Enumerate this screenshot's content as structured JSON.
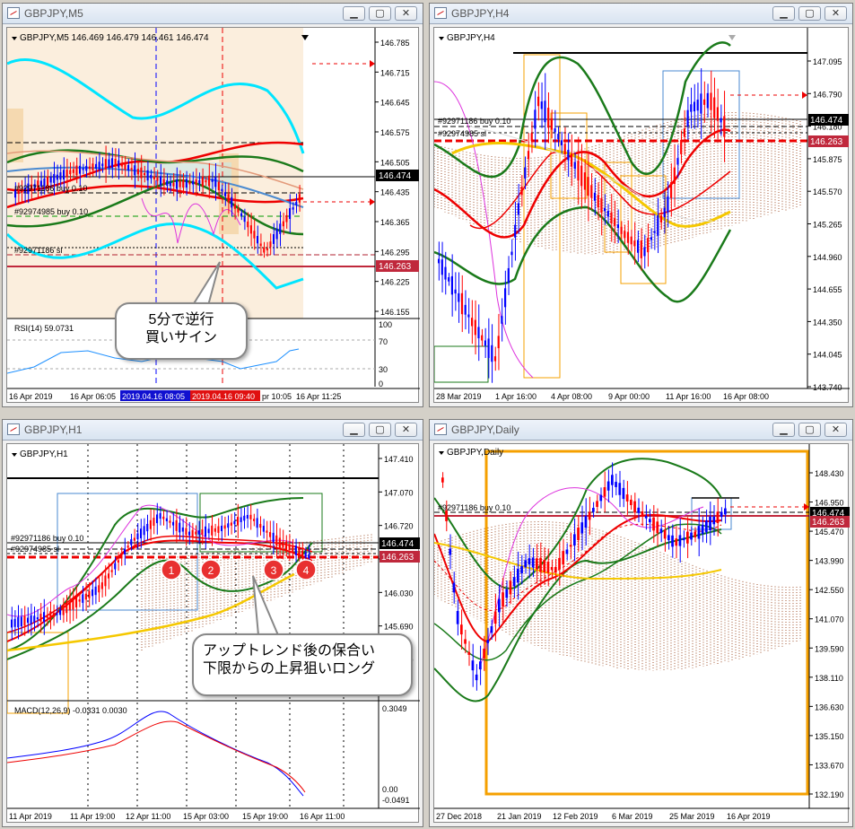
{
  "windows": {
    "m5": {
      "title": "GBPJPY,M5",
      "info": "GBPJPY,M5  146.469 146.479 146.461 146.474",
      "price_labels": [
        "146.785",
        "146.715",
        "146.645",
        "146.575",
        "146.505",
        "146.435",
        "146.365",
        "146.295",
        "146.225",
        "146.155"
      ],
      "current_price": "146.474",
      "level_price": "146.263",
      "order_labels": [
        "#92971186 buy 0.10",
        "#92974985 buy 0.10",
        "#92971186 sl"
      ],
      "rsi_label": "RSI(14) 59.0731",
      "rsi_levels": [
        "100",
        "70",
        "30",
        "0"
      ],
      "time_labels": [
        "16 Apr 2019",
        "16 Apr 06:05",
        "pr 10:05",
        "16 Apr 11:25"
      ],
      "time_marker_blue": "2019.04.16 08:05",
      "time_marker_red": "2019.04.16 09:40",
      "bubble_text": [
        "5分で逆行",
        "買いサイン"
      ]
    },
    "h4": {
      "title": "GBPJPY,H4",
      "info": "GBPJPY,H4",
      "price_labels": [
        "147.095",
        "146.790",
        "146.180",
        "145.875",
        "145.570",
        "145.265",
        "144.960",
        "144.655",
        "144.350",
        "144.045",
        "143.740"
      ],
      "current_price": "146.474",
      "level_price": "146.263",
      "order_labels": [
        "#92971186 buy 0.10",
        "#92974985 sl"
      ],
      "time_labels": [
        "28 Mar 2019",
        "1 Apr 16:00",
        "4 Apr 08:00",
        "9 Apr 00:00",
        "11 Apr 16:00",
        "16 Apr 08:00"
      ]
    },
    "h1": {
      "title": "GBPJPY,H1",
      "info": "GBPJPY,H1",
      "price_labels": [
        "147.410",
        "147.070",
        "146.720",
        "146.380",
        "146.030",
        "145.690",
        "145.340"
      ],
      "current_price": "146.474",
      "level_price": "146.263",
      "order_labels": [
        "#92971186 buy 0.10",
        "#92974985 sl"
      ],
      "macd_label": "MACD(12,26,9) -0.0331 0.0030",
      "macd_levels": [
        "0.3049",
        "0.00",
        "-0.0491"
      ],
      "time_labels": [
        "11 Apr 2019",
        "11 Apr 19:00",
        "12 Apr 11:00",
        "15 Apr 03:00",
        "15 Apr 19:00",
        "16 Apr 11:00"
      ],
      "markers": [
        "1",
        "2",
        "3",
        "4"
      ],
      "bubble_text": [
        "アップトレンド後の保合い",
        "下限からの上昇狙いロング"
      ]
    },
    "daily": {
      "title": "GBPJPY,Daily",
      "info": "GBPJPY,Daily",
      "price_labels": [
        "148.430",
        "146.950",
        "145.470",
        "143.990",
        "142.550",
        "141.070",
        "139.590",
        "138.110",
        "136.630",
        "135.150",
        "133.670",
        "132.190"
      ],
      "current_price": "146.474",
      "level_price": "146.263",
      "order_labels": [
        "#92971186 buy 0.10"
      ],
      "time_labels": [
        "27 Dec 2018",
        "21 Jan 2019",
        "12 Feb 2019",
        "6 Mar 2019",
        "25 Mar 2019",
        "16 Apr 2019"
      ]
    }
  },
  "colors": {
    "bull": "#0000ff",
    "bear": "#ff0000",
    "bg": "#ffffff",
    "shade": "#fbeedd",
    "cyan": "#00e5ff",
    "green": "#1a7a1a",
    "orange": "#f5a000",
    "magenta": "#dd33dd"
  }
}
